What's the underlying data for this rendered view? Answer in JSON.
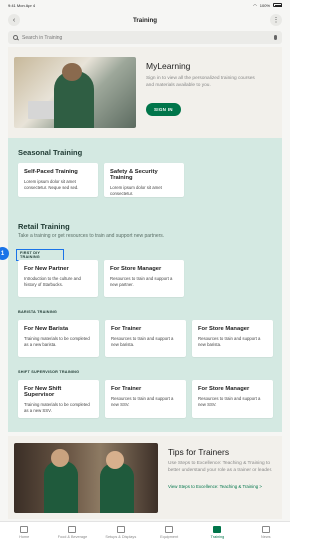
{
  "status_bar": {
    "time": "9:41",
    "date": "Mon Apr 4",
    "battery": "100%"
  },
  "nav": {
    "title": "Training",
    "back_icon": "chevron-left-icon",
    "more_icon": "more-icon"
  },
  "search": {
    "placeholder": "Search in Training"
  },
  "mylearning": {
    "title": "MyLearning",
    "description": "Sign in to view all the personalized training courses and materials available to you.",
    "button": "SIGN IN"
  },
  "seasonal": {
    "title": "Seasonal Training",
    "cards": [
      {
        "title": "Self-Paced Training",
        "desc": "Lorem ipsum dolor sit amet consectetur. Neque sed sed."
      },
      {
        "title": "Safety & Security Training",
        "desc": "Lorem ipsum dolor sit amet consectetur."
      }
    ]
  },
  "retail": {
    "title": "Retail Training",
    "subtitle": "Take a training or get resources to train and support new partners.",
    "groups": [
      {
        "label": "FIRST DIY TRAINING",
        "cards": [
          {
            "title": "For New Partner",
            "desc": "Introduction to the culture and history of Starbucks."
          },
          {
            "title": "For Store Manager",
            "desc": "Resources to train and support a new partner."
          }
        ]
      },
      {
        "label": "BARISTA TRAINING",
        "cards": [
          {
            "title": "For New Barista",
            "desc": "Training materials to be completed as a new barista."
          },
          {
            "title": "For Trainer",
            "desc": "Resources to train and support a new barista."
          },
          {
            "title": "For Store Manager",
            "desc": "Resources to train and support a new barista."
          }
        ]
      },
      {
        "label": "SHIFT SUPERVISOR TRAINING",
        "cards": [
          {
            "title": "For New Shift Supervisor",
            "desc": "Training materials to be completed as a new SSV."
          },
          {
            "title": "For Trainer",
            "desc": "Resources to train and support a new SSV."
          },
          {
            "title": "For Store Manager",
            "desc": "Resources to train and support a new SSV."
          }
        ]
      }
    ]
  },
  "tips": {
    "title": "Tips for Trainers",
    "description": "Use Steps to Excellence: Teaching & Training to better understand your role as a trainer or leader.",
    "link": "View Steps to Excellence: Teaching & Training >"
  },
  "annotation_badge": "1",
  "tabs": [
    {
      "label": "Home",
      "icon": "home-icon",
      "active": false
    },
    {
      "label": "Food & Beverage",
      "icon": "cup-icon",
      "active": false
    },
    {
      "label": "Setups & Displays",
      "icon": "clipboard-icon",
      "active": false
    },
    {
      "label": "Equipment",
      "icon": "tools-icon",
      "active": false
    },
    {
      "label": "Training",
      "icon": "people-icon",
      "active": true
    },
    {
      "label": "News",
      "icon": "news-icon",
      "active": false
    }
  ],
  "colors": {
    "accent": "#00754a",
    "section_bg": "#d4e9e2",
    "dark_green": "#1e3932"
  }
}
